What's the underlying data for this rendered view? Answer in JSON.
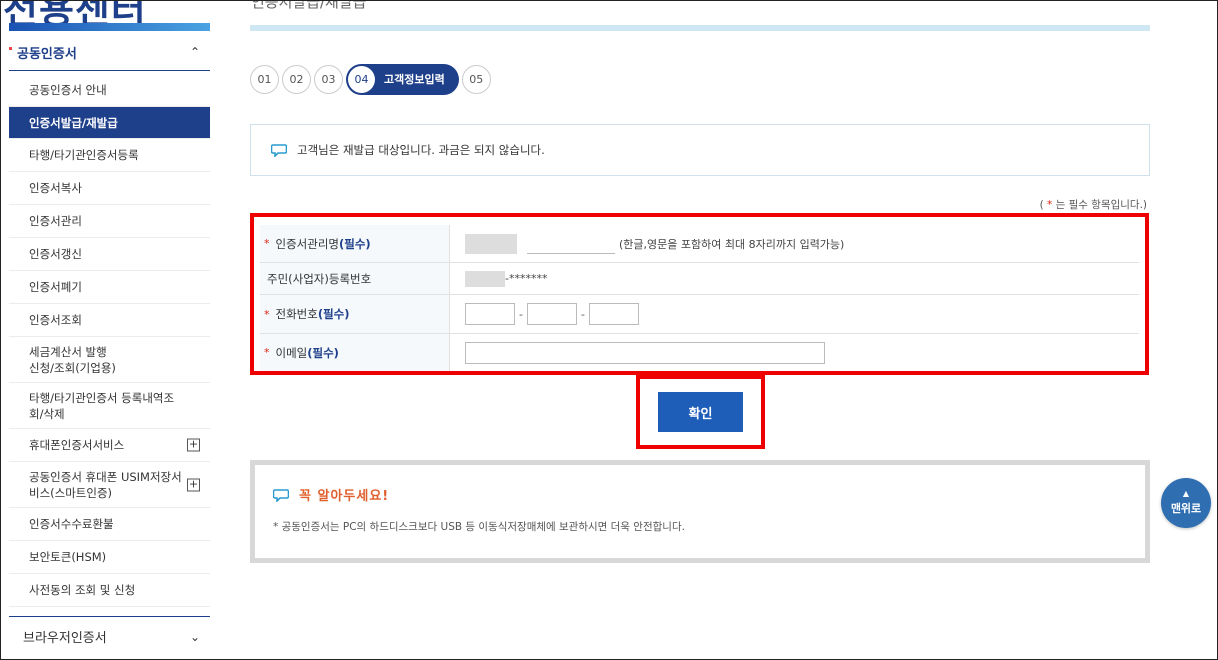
{
  "sidebar": {
    "brand": "전용센터",
    "section_title": "공동인증서",
    "section_chevron": "⌃",
    "items": [
      {
        "label": "공동인증서 안내",
        "active": false,
        "expand": false,
        "h": 34
      },
      {
        "label": "인증서발급/재발급",
        "active": true,
        "expand": false,
        "h": 32
      },
      {
        "label": "타행/타기관인증서등록",
        "active": false,
        "expand": false,
        "h": 33
      },
      {
        "label": "인증서복사",
        "active": false,
        "expand": false,
        "h": 33
      },
      {
        "label": "인증서관리",
        "active": false,
        "expand": false,
        "h": 33
      },
      {
        "label": "인증서갱신",
        "active": false,
        "expand": false,
        "h": 33
      },
      {
        "label": "인증서폐기",
        "active": false,
        "expand": false,
        "h": 33
      },
      {
        "label": "인증서조회",
        "active": false,
        "expand": false,
        "h": 33
      },
      {
        "label": "세금계산서 발행\n신청/조회(기업용)",
        "active": false,
        "expand": false,
        "h": 46
      },
      {
        "label": "타행/타기관인증서 등록내역조\n회/삭제",
        "active": false,
        "expand": false,
        "h": 46
      },
      {
        "label": "휴대폰인증서서비스",
        "active": false,
        "expand": true,
        "h": 33
      },
      {
        "label": "공동인증서 휴대폰 USIM저장서\n비스(스마트인증)",
        "active": false,
        "expand": true,
        "h": 46
      },
      {
        "label": "인증서수수료환불",
        "active": false,
        "expand": false,
        "h": 33
      },
      {
        "label": "보안토큰(HSM)",
        "active": false,
        "expand": false,
        "h": 33
      },
      {
        "label": "사전동의 조회 및 신청",
        "active": false,
        "expand": false,
        "h": 33
      }
    ],
    "footer_title": "브라우저인증서",
    "footer_chevron": "⌄"
  },
  "page": {
    "title_clip": "인증서발급/재발급"
  },
  "steps": {
    "items": [
      "01",
      "02",
      "03"
    ],
    "active_num": "04",
    "active_label": "고객정보입력",
    "last": "05"
  },
  "notice": {
    "text": "고객님은 재발급 대상입니다. 과금은 되지 않습니다."
  },
  "required_note": {
    "open": "(",
    "star": "*",
    "text": "는 필수 항목입니다.)"
  },
  "form": {
    "required_tag": "(필수)",
    "rows": {
      "cert_name": {
        "label": "인증서관리명",
        "value": "",
        "hint": "(한글,영문을 포함하여 최대 8자리까지 입력가능)"
      },
      "reg_no": {
        "label": "주민(사업자)등록번호",
        "masked_suffix": "-*******"
      },
      "phone": {
        "label": "전화번호",
        "parts": [
          "",
          "",
          ""
        ],
        "sep": "-"
      },
      "email": {
        "label": "이메일",
        "value": ""
      }
    }
  },
  "confirm_button": "확인",
  "info": {
    "title": "꼭 알아두세요!",
    "text": "* 공동인증서는 PC의 하드디스크보다 USB 등 이동식저장매체에 보관하시면 더욱 안전합니다."
  },
  "top_button": {
    "arrow": "▲",
    "label": "맨위로"
  },
  "colors": {
    "primary": "#1e3f8a",
    "button": "#1e5db8",
    "highlight": "#e00000",
    "accent_orange": "#e0602d",
    "top_button": "#2f6fb1"
  }
}
